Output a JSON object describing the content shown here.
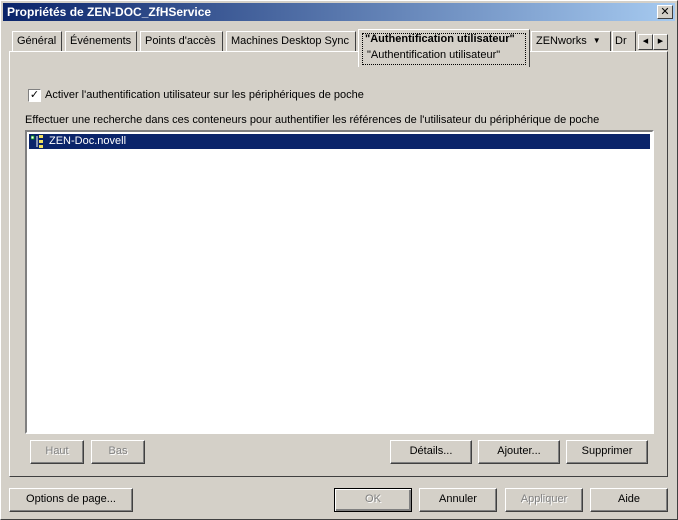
{
  "window": {
    "title": "Propriétés de ZEN-DOC_ZfHService",
    "close_glyph": "✕"
  },
  "tabs": [
    {
      "label": "Général"
    },
    {
      "label": "Événements"
    },
    {
      "label": "Points d'accès"
    },
    {
      "label": "Machines Desktop Sync"
    },
    {
      "label": "\"Authentification utilisateur\"",
      "sublabel": "\"Authentification utilisateur\"",
      "active": true
    },
    {
      "label": "ZENworks"
    },
    {
      "label": "Dr"
    }
  ],
  "tab_scroll": {
    "left": "◀",
    "right": "▶"
  },
  "auth": {
    "checkbox_label": "Activer l'authentification utilisateur sur les périphériques de poche",
    "checked": true,
    "check_glyph": "✓",
    "search_label": "Effectuer une recherche dans ces conteneurs pour authentifier les références de l'utilisateur du périphérique de poche",
    "containers": [
      {
        "name": "ZEN-Doc.novell",
        "selected": true
      }
    ]
  },
  "list_buttons": {
    "up": "Haut",
    "down": "Bas",
    "details": "Détails...",
    "add": "Ajouter...",
    "remove": "Supprimer"
  },
  "dialog_buttons": {
    "page_options": "Options de page...",
    "ok": "OK",
    "cancel": "Annuler",
    "apply": "Appliquer",
    "help": "Aide"
  }
}
